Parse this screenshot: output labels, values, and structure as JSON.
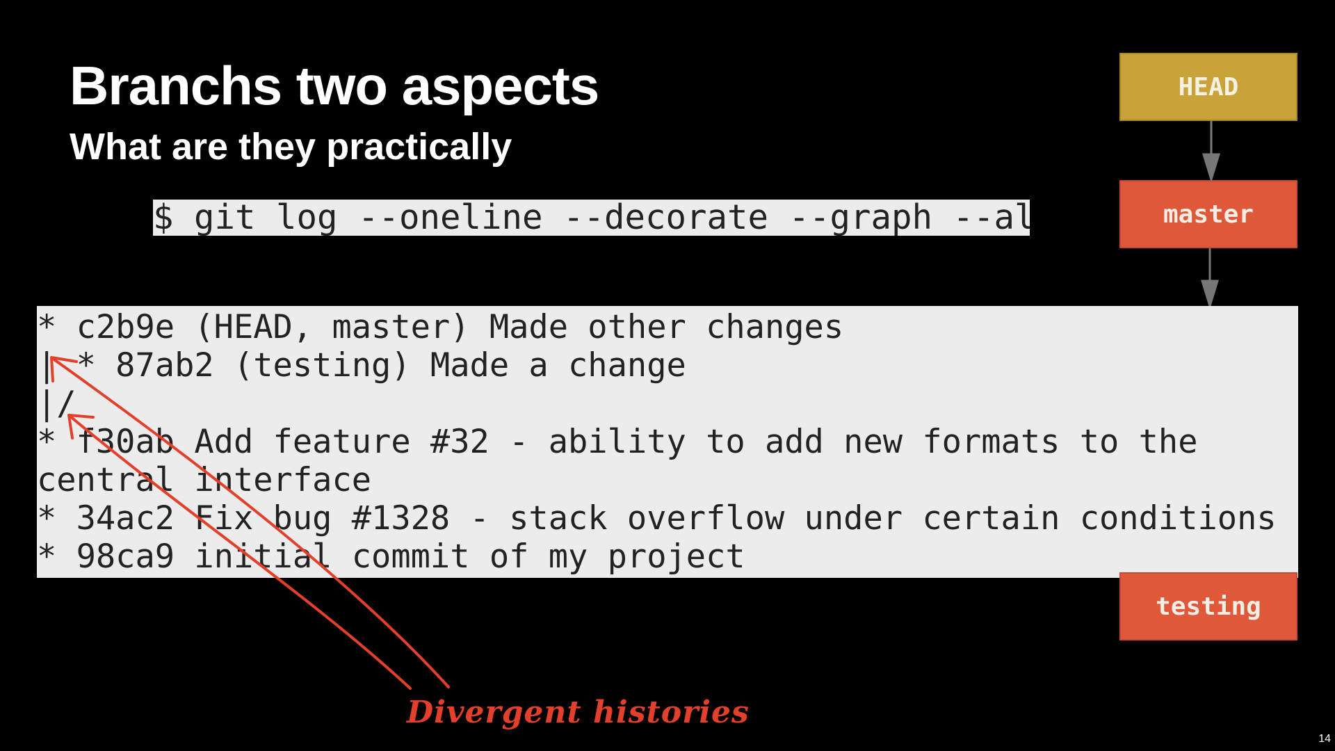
{
  "slide": {
    "title": "Branchs two aspects",
    "subtitle": "What are they practically",
    "command": "$ git log --oneline --decorate --graph --all",
    "log_lines": [
      "* c2b9e (HEAD, master) Made other changes",
      "| * 87ab2 (testing) Made a change",
      "|/",
      "* f30ab Add feature #32 - ability to add new formats to the",
      "central interface",
      "* 34ac2 Fix bug #1328 - stack overflow under certain conditions",
      "* 98ca9 initial commit of my project"
    ],
    "annotation": "Divergent histories",
    "page_number": "14"
  },
  "diagram": {
    "head_label": "HEAD",
    "master_label": "master",
    "testing_label": "testing",
    "colors": {
      "head": "#c8a33a",
      "branch": "#e0583a",
      "annotation": "#e2402b",
      "connector": "#777777"
    }
  }
}
